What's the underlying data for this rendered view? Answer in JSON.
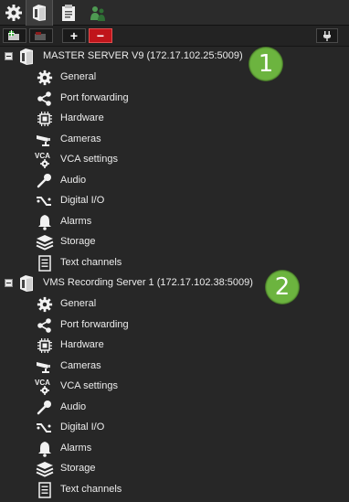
{
  "tabs": [
    {
      "name": "settings",
      "icon": "gear-icon"
    },
    {
      "name": "servers",
      "icon": "server-icon"
    },
    {
      "name": "clipboard",
      "icon": "clipboard-icon"
    },
    {
      "name": "users",
      "icon": "users-icon"
    }
  ],
  "toolbar": {
    "add_label": "+",
    "remove_label": "−"
  },
  "servers": [
    {
      "label": "MASTER SERVER V9 (172.17.102.25:5009)",
      "badge": "1",
      "items": [
        "General",
        "Port forwarding",
        "Hardware",
        "Cameras",
        "VCA settings",
        "Audio",
        "Digital I/O",
        "Alarms",
        "Storage",
        "Text channels"
      ]
    },
    {
      "label": "VMS Recording Server 1 (172.17.102.38:5009)",
      "badge": "2",
      "items": [
        "General",
        "Port forwarding",
        "Hardware",
        "Cameras",
        "VCA settings",
        "Audio",
        "Digital I/O",
        "Alarms",
        "Storage",
        "Text channels"
      ]
    }
  ],
  "colors": {
    "background": "#272727",
    "badge": "#6cb43f",
    "remove": "#c0141a"
  }
}
